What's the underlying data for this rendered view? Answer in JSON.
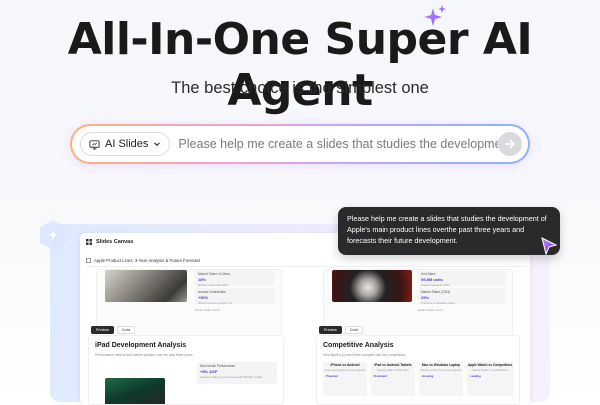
{
  "hero": {
    "title": "All-In-One Super AI Agent",
    "subtitle": "The best choice is the simplest one"
  },
  "prompt": {
    "mode_label": "AI Slides",
    "placeholder": "Please help me create a slides that studies the development of..."
  },
  "chat_bubble": {
    "text": "Please help me create a slides that studies the development of Apple's main product lines overthe past three years and forecasts their future development."
  },
  "canvas": {
    "header": "Slides Canvas",
    "doc_title": "Apple Product Lines: 3-Year Analysis & Future Forecast",
    "left_top_stats": [
      {
        "label": "Market Share in China",
        "value": "18%",
        "note": "Market Leadership 2023"
      },
      {
        "label": "Annual Contribution",
        "value": "+50%",
        "note": "iPhone revenue growth YoY"
      }
    ],
    "left_top_fine": "Market Share Trend",
    "right_top_stats": [
      {
        "label": "Unit Sales",
        "value": "59.8M units",
        "note": "Global shipments 2023"
      },
      {
        "label": "Market Share (2023)",
        "value": "29%",
        "note": "Premium smartwatch share"
      }
    ],
    "right_top_fine": "Market Share Trend",
    "tabs": [
      "Preview",
      "Code"
    ],
    "left_section": {
      "title": "iPad Development Analysis",
      "subtitle": "Performance metrics and market position over the past three years",
      "stat_label": "New Model Performance",
      "stat_value": "+8% ASP",
      "stat_note": "Average selling price increase with M2/M4 models"
    },
    "right_section": {
      "title": "Competitive Analysis",
      "subtitle": "How Apple's product lines compare with key competitors",
      "boxes": [
        {
          "title": "iPhone vs Android",
          "sub": "Apple dominates premium segment",
          "value": "Premium"
        },
        {
          "title": "iPad vs Android Tablets",
          "sub": "Leading tablet market share",
          "value": "Dominant"
        },
        {
          "title": "Mac vs Windows Laptop",
          "sub": "Steady growth in premium segment",
          "value": "Growing"
        },
        {
          "title": "Apple Watch vs Competitors",
          "sub": "Market leader in smartwatches",
          "value": "Leading"
        }
      ]
    }
  },
  "colors": {
    "accent": "#4b3ad3",
    "bubble_bg": "#2a2a2c",
    "prompt_gradient": [
      "#ffb07a",
      "#f4a3c9",
      "#b9a6ff",
      "#89b4ff"
    ]
  },
  "icons": [
    "sparkle-icon",
    "slides-icon",
    "chevron-down-icon",
    "send-arrow-icon",
    "hexagon-logo-icon",
    "cursor-arrow-icon"
  ]
}
